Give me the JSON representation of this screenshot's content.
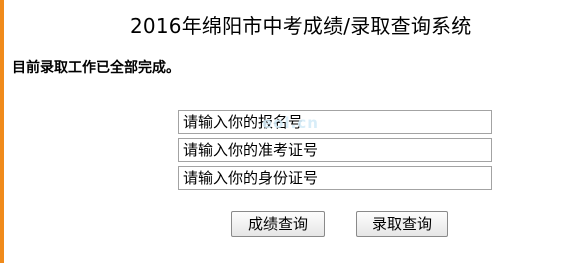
{
  "header": {
    "title": "2016年绵阳市中考成绩/录取查询系统"
  },
  "notice": {
    "text": "目前录取工作已全部完成。"
  },
  "form": {
    "registration_number": {
      "value": "",
      "placeholder": "请输入你的报名号"
    },
    "exam_ticket_number": {
      "value": "",
      "placeholder": "请输入你的准考证号"
    },
    "id_number": {
      "value": "",
      "placeholder": "请输入你的身份证号"
    },
    "watermark": "eol.cn"
  },
  "actions": {
    "score_query_label": "成绩查询",
    "admission_query_label": "录取查询"
  },
  "colors": {
    "accent": "#f08a1a",
    "watermark": "#d4ecf8"
  }
}
